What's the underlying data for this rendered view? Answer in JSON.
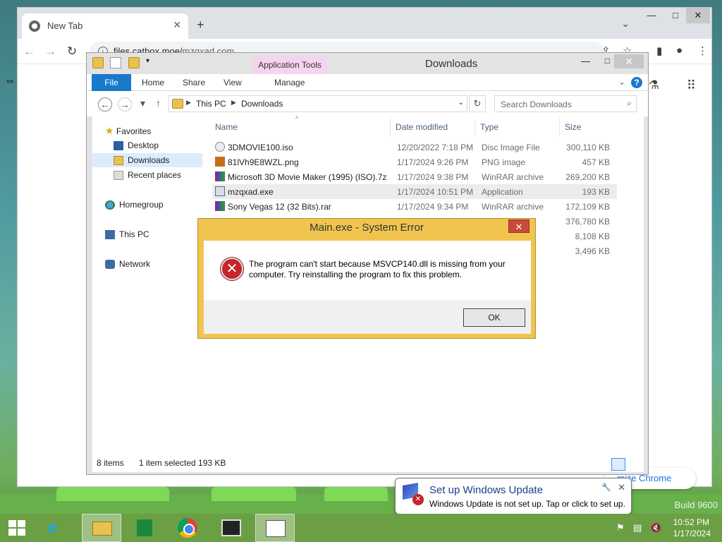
{
  "chrome": {
    "tab_title": "New Tab",
    "new_tab_symbol": "+",
    "url_host": "files.catbox.moe/",
    "url_path": "mzqxad.com",
    "customize_label": "mize Chrome",
    "icons": [
      "chrome-favicon",
      "back-arrow",
      "forward-arrow",
      "reload",
      "info",
      "share",
      "bookmark-star",
      "sidebar",
      "profile",
      "kebab-menu",
      "apps-grid",
      "labs-flask"
    ]
  },
  "explorer": {
    "title": "Downloads",
    "app_tools_label": "Application Tools",
    "ribbon_tabs": {
      "file": "File",
      "home": "Home",
      "share": "Share",
      "view": "View",
      "manage": "Manage"
    },
    "breadcrumb": {
      "root": "This PC",
      "folder": "Downloads"
    },
    "search_placeholder": "Search Downloads",
    "nav": {
      "favorites": "Favorites",
      "desktop": "Desktop",
      "downloads": "Downloads",
      "recent": "Recent places",
      "homegroup": "Homegroup",
      "this_pc": "This PC",
      "network": "Network"
    },
    "columns": {
      "name": "Name",
      "date": "Date modified",
      "type": "Type",
      "size": "Size"
    },
    "files": [
      {
        "name": "3DMOVIE100.iso",
        "date": "12/20/2022 7:18 PM",
        "type": "Disc Image File",
        "size": "300,110 KB"
      },
      {
        "name": "81lVh9E8WZL.png",
        "date": "1/17/2024 9:26 PM",
        "type": "PNG image",
        "size": "457 KB"
      },
      {
        "name": "Microsoft 3D Movie Maker (1995) (ISO).7z",
        "date": "1/17/2024 9:38 PM",
        "type": "WinRAR archive",
        "size": "269,200 KB"
      },
      {
        "name": "mzqxad.exe",
        "date": "1/17/2024 10:51 PM",
        "type": "Application",
        "size": "193 KB"
      },
      {
        "name": "Sony Vegas 12 (32 Bits).rar",
        "date": "1/17/2024 9:34 PM",
        "type": "WinRAR archive",
        "size": "172,109 KB"
      },
      {
        "name": "",
        "date": "",
        "type": "ive",
        "size": "376,780 KB"
      },
      {
        "name": "",
        "date": "",
        "type": "",
        "size": "8,108 KB"
      },
      {
        "name": "",
        "date": "",
        "type": "",
        "size": "3,496 KB"
      }
    ],
    "status": {
      "count": "8 items",
      "selected": "1 item selected  193 KB"
    }
  },
  "error_dialog": {
    "title": "Main.exe - System Error",
    "message": "The program can't start because MSVCP140.dll is missing from your computer. Try reinstalling the program to fix this problem.",
    "ok_label": "OK"
  },
  "notification": {
    "title": "Set up Windows Update",
    "text": "Windows Update is not set up. Tap or click to set up."
  },
  "taskbar": {
    "apps": [
      "start",
      "internet-explorer",
      "file-explorer",
      "store",
      "chrome",
      "video-app",
      "main-app"
    ],
    "time": "10:52 PM",
    "date": "1/17/2024"
  },
  "desktop": {
    "build_text": "Build 9600"
  },
  "colors": {
    "accent": "#1979ca",
    "error_frame": "#f0c54f",
    "error_icon": "#c8242b",
    "taskbar": "#6b9f44"
  }
}
